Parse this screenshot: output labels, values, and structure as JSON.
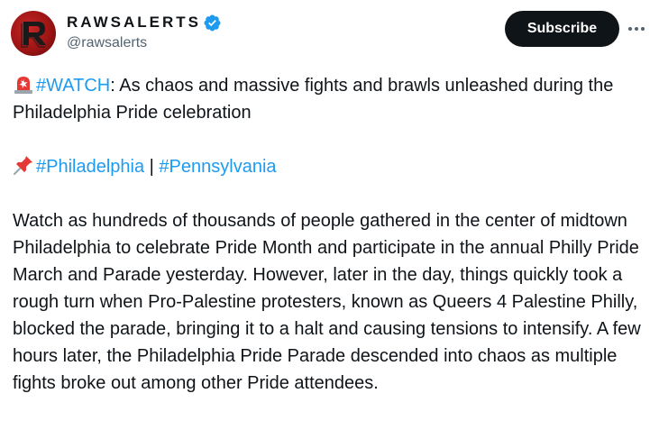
{
  "author": {
    "display_name": "RAWSALERTS",
    "handle": "@rawsalerts",
    "verified": true,
    "avatar_icon": "r-logo-icon",
    "avatar_color": "#b71c1c"
  },
  "actions": {
    "subscribe_label": "Subscribe",
    "more_icon": "more-horizontal-icon"
  },
  "tweet": {
    "line1": {
      "emoji": "rotating-light-icon",
      "hashtag": "#WATCH",
      "text": ": As chaos and massive fights and brawls unleashed during the Philadelphia Pride celebration"
    },
    "line2": {
      "emoji": "pushpin-icon",
      "hashtag1": "#Philadelphia",
      "separator": " | ",
      "hashtag2": "#Pennsylvania"
    },
    "paragraph": "Watch as hundreds of thousands of people gathered in the center of midtown Philadelphia to celebrate Pride Month and participate in the annual Philly Pride March and Parade yesterday. However, later in the day, things quickly took a rough turn when Pro-Palestine protesters, known as Queers 4 Palestine Philly, blocked the parade, bringing it to a halt and causing tensions to intensify. A few hours later, the Philadelphia Pride Parade descended into chaos as multiple fights broke out among other Pride attendees."
  },
  "colors": {
    "link": "#1d9bf0",
    "text": "#0f1419",
    "muted": "#536471",
    "button_bg": "#0f1419"
  }
}
